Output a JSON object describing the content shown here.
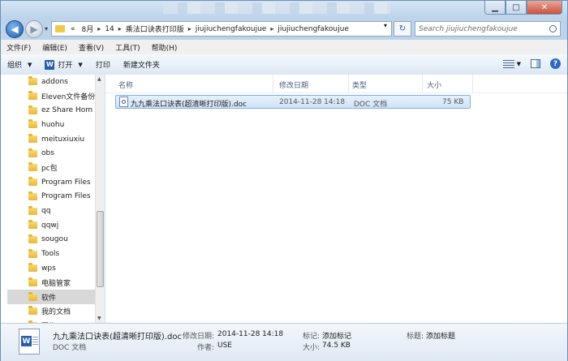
{
  "navigation": {
    "address_path": [
      "«",
      "8月",
      "14",
      "乘法口诀表打印版",
      "jiujiuchengfakoujue",
      "jiujiuchengfakoujue"
    ],
    "search_placeholder": "Search jiujiuchengfakoujue"
  },
  "menubar": {
    "items": [
      "文件(F)",
      "编辑(E)",
      "查看(V)",
      "工具(T)",
      "帮助(H)"
    ]
  },
  "toolbar": {
    "organize_label": "组织",
    "open_label": "打开",
    "print_label": "打印",
    "new_folder_label": "新建文件夹"
  },
  "sidebar": {
    "items": [
      {
        "label": "addons"
      },
      {
        "label": "Eleven文件备份"
      },
      {
        "label": "ez Share Hom"
      },
      {
        "label": "huohu"
      },
      {
        "label": "meituxiuxiu"
      },
      {
        "label": "obs"
      },
      {
        "label": "pc包"
      },
      {
        "label": "Program Files"
      },
      {
        "label": "Program Files"
      },
      {
        "label": "qq"
      },
      {
        "label": "qqwj"
      },
      {
        "label": "sougou"
      },
      {
        "label": "Tools"
      },
      {
        "label": "wps"
      },
      {
        "label": "电脑管家"
      },
      {
        "label": "软件"
      },
      {
        "label": "我的文档"
      },
      {
        "label": "写作"
      }
    ],
    "selected_index": 15
  },
  "file_list": {
    "columns": [
      "名称",
      "修改日期",
      "类型",
      "大小"
    ],
    "rows": [
      {
        "name": "九九乘法口诀表(超清晰打印版).doc",
        "date": "2014-11-28 14:18",
        "type": "DOC 文档",
        "size": "75 KB"
      }
    ]
  },
  "details": {
    "file_name": "九九乘法口诀表(超清晰打印版).doc",
    "file_type": "DOC 文档",
    "modified_label": "修改日期:",
    "modified_value": "2014-11-28 14:18",
    "author_label": "作者:",
    "author_value": "USE",
    "tags_label": "标记:",
    "tags_value": "添加标记",
    "size_label": "大小:",
    "size_value": "74.5 KB",
    "title_label": "标题:",
    "title_value": "添加标题"
  },
  "colors": {
    "selection": "#cfe4f8",
    "frame": "#bcd3ea"
  }
}
